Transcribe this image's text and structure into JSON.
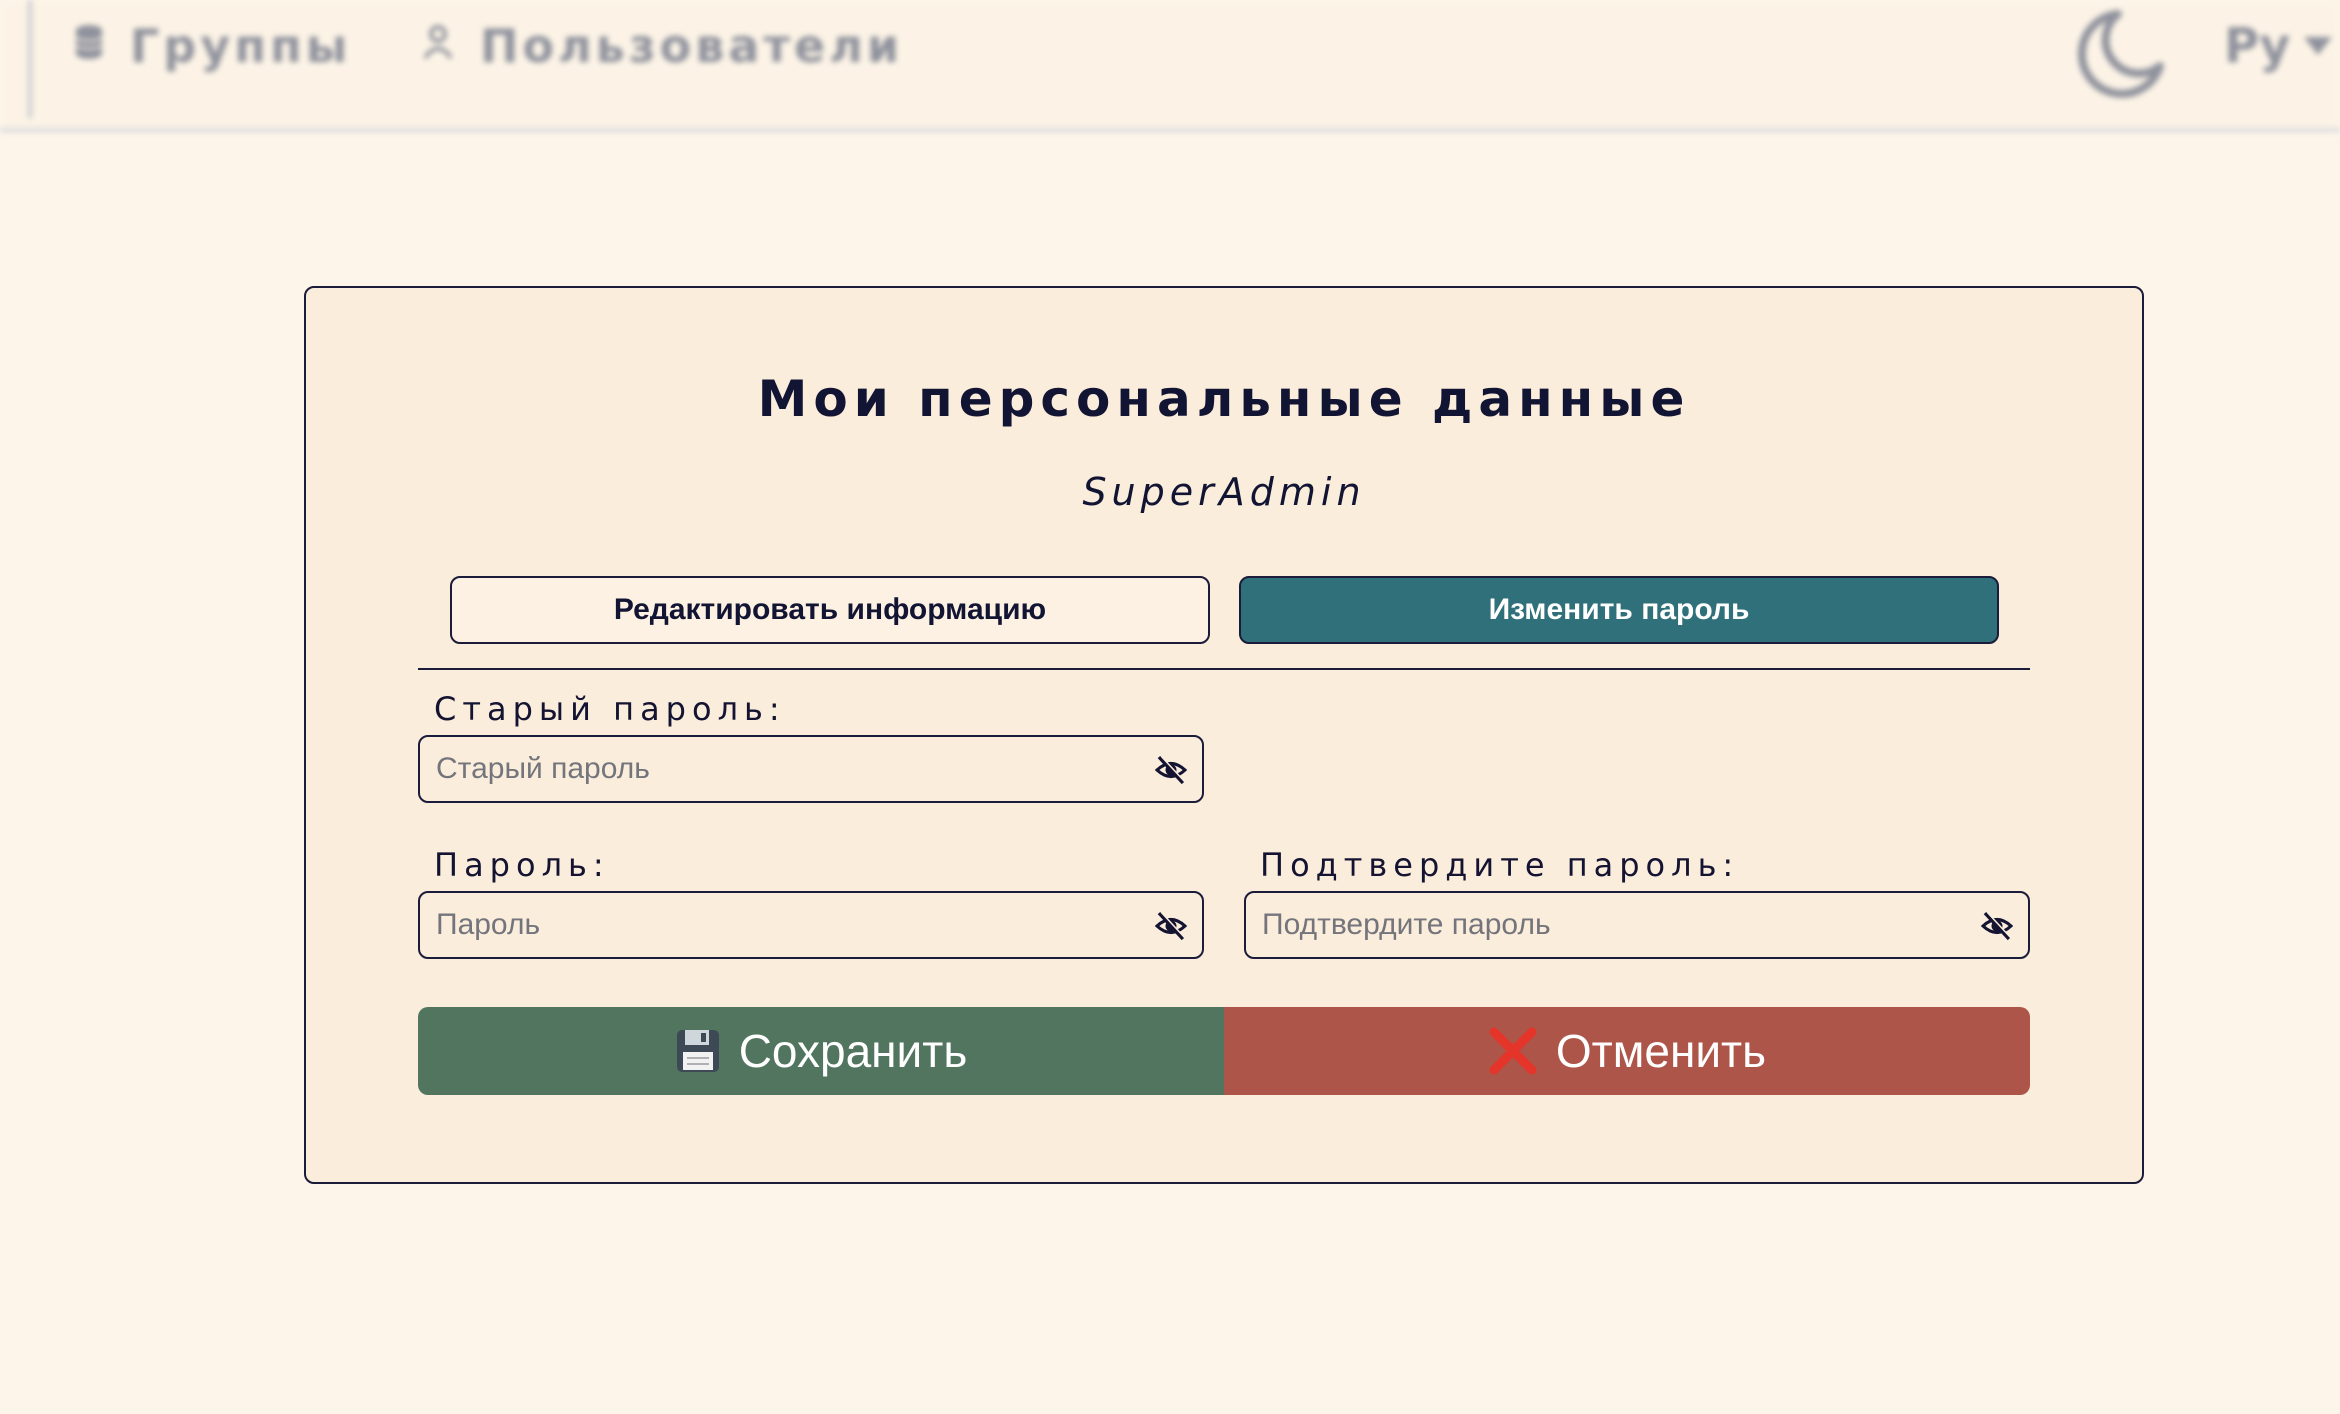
{
  "nav": {
    "groups_label": "Группы",
    "groups_icon": "database-icon",
    "users_label": "Пользователи",
    "users_icon": "user-icon",
    "theme_icon": "moon-icon",
    "language_value": "Ру"
  },
  "profile": {
    "title": "Мои персональные данные",
    "username": "SuperAdmin",
    "tabs": {
      "edit_info": "Редактировать информацию",
      "change_password": "Изменить пароль",
      "active": "change_password"
    },
    "fields": {
      "old_password": {
        "label": "Старый пароль:",
        "placeholder": "Старый пароль",
        "value": ""
      },
      "new_password": {
        "label": "Пароль:",
        "placeholder": "Пароль",
        "value": ""
      },
      "confirm_password": {
        "label": "Подтвердите пароль:",
        "placeholder": "Подтвердите пароль",
        "value": ""
      }
    },
    "actions": {
      "save_label": "Сохранить",
      "save_icon": "floppy-disk-icon",
      "cancel_label": "Отменить",
      "cancel_icon": "cross-mark-icon"
    }
  },
  "colors": {
    "page_background": "#fdf5ea",
    "card_background": "#fbeddb",
    "accent_teal": "#2f707a",
    "save_green": "#52755f",
    "cancel_red": "#ad5548",
    "text_dark": "#121433"
  }
}
